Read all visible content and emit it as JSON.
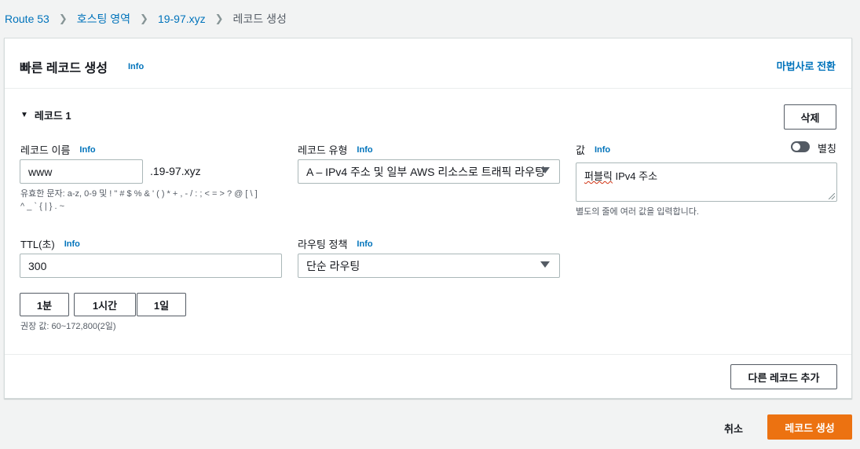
{
  "breadcrumb": {
    "items": [
      "Route 53",
      "호스팅 영역",
      "19-97.xyz"
    ],
    "current": "레코드 생성"
  },
  "panel": {
    "title": "빠른 레코드 생성",
    "info": "Info",
    "wizard_link": "마법사로 전환"
  },
  "record": {
    "header": "레코드 1",
    "delete_label": "삭제",
    "name": {
      "label": "레코드 이름",
      "info": "Info",
      "value": "www",
      "suffix": ".19-97.xyz",
      "hint_line1": "유효한 문자: a-z, 0-9 및 ! \" # $ % & ' ( ) * + , - / : ; < = > ? @ [ \\ ]",
      "hint_line2": "^ _ ` { | } . ~"
    },
    "type": {
      "label": "레코드 유형",
      "info": "Info",
      "value": "A – IPv4 주소 및 일부 AWS 리소스로 트래픽 라우팅"
    },
    "value": {
      "label": "값",
      "info": "Info",
      "alias_label": "별칭",
      "text_before": "퍼블릭",
      "text_after": " IPv4 주소",
      "hint": "별도의 줄에 여러 값을 입력합니다."
    },
    "ttl": {
      "label": "TTL(초)",
      "info": "Info",
      "value": "300",
      "presets": [
        "1분",
        "1시간",
        "1일"
      ],
      "hint": "권장 값: 60~172,800(2일)"
    },
    "routing": {
      "label": "라우팅 정책",
      "info": "Info",
      "value": "단순 라우팅"
    }
  },
  "add_record_label": "다른 레코드 추가",
  "footer": {
    "cancel_label": "취소",
    "create_label": "레코드 생성"
  },
  "colors": {
    "link": "#0073bb",
    "primary": "#ec7211",
    "background": "#f2f3f3"
  }
}
